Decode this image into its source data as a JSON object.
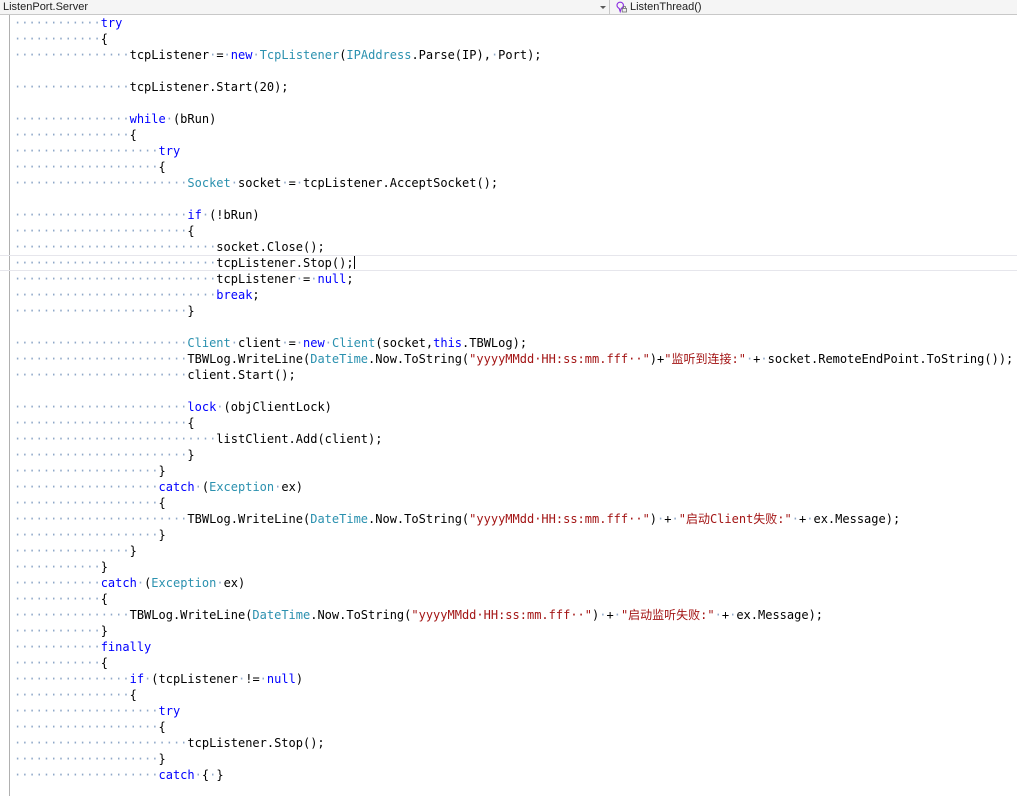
{
  "nav": {
    "type_combo": {
      "value": "ListenPort.Server",
      "dropdown_icon": "chevron-down-icon"
    },
    "member_combo": {
      "value": "ListenThread()",
      "icon": "private-method-icon"
    }
  },
  "editor": {
    "current_line_index": 15,
    "caret_after_text": "tcpListener.Stop();",
    "colors": {
      "keyword": "#0000ff",
      "type": "#2b91af",
      "string": "#a31515",
      "plain": "#000000",
      "whitespace_dot": "#8fa8c8",
      "current_line_border": "#e6e6ec",
      "margin_border": "#b0b0b0",
      "background": "#ffffff"
    },
    "lines": [
      [
        [
          "ws",
          "············"
        ],
        [
          "kw",
          "try"
        ]
      ],
      [
        [
          "ws",
          "············"
        ],
        [
          "pl",
          "{"
        ]
      ],
      [
        [
          "ws",
          "················"
        ],
        [
          "pl",
          "tcpListener"
        ],
        [
          "ws",
          "·"
        ],
        [
          "pl",
          "="
        ],
        [
          "ws",
          "·"
        ],
        [
          "kw",
          "new"
        ],
        [
          "ws",
          "·"
        ],
        [
          "typ",
          "TcpListener"
        ],
        [
          "pl",
          "("
        ],
        [
          "typ",
          "IPAddress"
        ],
        [
          "pl",
          ".Parse(IP),"
        ],
        [
          "ws",
          "·"
        ],
        [
          "pl",
          "Port);"
        ]
      ],
      [],
      [
        [
          "ws",
          "················"
        ],
        [
          "pl",
          "tcpListener.Start(20);"
        ]
      ],
      [],
      [
        [
          "ws",
          "················"
        ],
        [
          "kw",
          "while"
        ],
        [
          "ws",
          "·"
        ],
        [
          "pl",
          "(bRun)"
        ]
      ],
      [
        [
          "ws",
          "················"
        ],
        [
          "pl",
          "{"
        ]
      ],
      [
        [
          "ws",
          "····················"
        ],
        [
          "kw",
          "try"
        ]
      ],
      [
        [
          "ws",
          "····················"
        ],
        [
          "pl",
          "{"
        ]
      ],
      [
        [
          "ws",
          "························"
        ],
        [
          "typ",
          "Socket"
        ],
        [
          "ws",
          "·"
        ],
        [
          "pl",
          "socket"
        ],
        [
          "ws",
          "·"
        ],
        [
          "pl",
          "="
        ],
        [
          "ws",
          "·"
        ],
        [
          "pl",
          "tcpListener.AcceptSocket();"
        ]
      ],
      [],
      [
        [
          "ws",
          "························"
        ],
        [
          "kw",
          "if"
        ],
        [
          "ws",
          "·"
        ],
        [
          "pl",
          "(!bRun)"
        ]
      ],
      [
        [
          "ws",
          "························"
        ],
        [
          "pl",
          "{"
        ]
      ],
      [
        [
          "ws",
          "····························"
        ],
        [
          "pl",
          "socket.Close();"
        ]
      ],
      [
        [
          "ws",
          "····························"
        ],
        [
          "pl",
          "tcpListener.Stop();"
        ]
      ],
      [
        [
          "ws",
          "····························"
        ],
        [
          "pl",
          "tcpListener"
        ],
        [
          "ws",
          "·"
        ],
        [
          "pl",
          "="
        ],
        [
          "ws",
          "·"
        ],
        [
          "kw",
          "null"
        ],
        [
          "pl",
          ";"
        ]
      ],
      [
        [
          "ws",
          "····························"
        ],
        [
          "kw",
          "break"
        ],
        [
          "pl",
          ";"
        ]
      ],
      [
        [
          "ws",
          "························"
        ],
        [
          "pl",
          "}"
        ]
      ],
      [],
      [
        [
          "ws",
          "························"
        ],
        [
          "typ",
          "Client"
        ],
        [
          "ws",
          "·"
        ],
        [
          "pl",
          "client"
        ],
        [
          "ws",
          "·"
        ],
        [
          "pl",
          "="
        ],
        [
          "ws",
          "·"
        ],
        [
          "kw",
          "new"
        ],
        [
          "ws",
          "·"
        ],
        [
          "typ",
          "Client"
        ],
        [
          "pl",
          "(socket,"
        ],
        [
          "kw",
          "this"
        ],
        [
          "pl",
          ".TBWLog);"
        ]
      ],
      [
        [
          "ws",
          "························"
        ],
        [
          "pl",
          "TBWLog.WriteLine("
        ],
        [
          "typ",
          "DateTime"
        ],
        [
          "pl",
          ".Now.ToString("
        ],
        [
          "str",
          "\"yyyyMMdd·HH:ss:mm.fff··\""
        ],
        [
          "pl",
          ")+"
        ],
        [
          "str",
          "\"监听到连接:\""
        ],
        [
          "ws",
          "·"
        ],
        [
          "pl",
          "+"
        ],
        [
          "ws",
          "·"
        ],
        [
          "pl",
          "socket.RemoteEndPoint.ToString());"
        ]
      ],
      [
        [
          "ws",
          "························"
        ],
        [
          "pl",
          "client.Start();"
        ]
      ],
      [],
      [
        [
          "ws",
          "························"
        ],
        [
          "kw",
          "lock"
        ],
        [
          "ws",
          "·"
        ],
        [
          "pl",
          "(objClientLock)"
        ]
      ],
      [
        [
          "ws",
          "························"
        ],
        [
          "pl",
          "{"
        ]
      ],
      [
        [
          "ws",
          "····························"
        ],
        [
          "pl",
          "listClient.Add(client);"
        ]
      ],
      [
        [
          "ws",
          "························"
        ],
        [
          "pl",
          "}"
        ]
      ],
      [
        [
          "ws",
          "····················"
        ],
        [
          "pl",
          "}"
        ]
      ],
      [
        [
          "ws",
          "····················"
        ],
        [
          "kw",
          "catch"
        ],
        [
          "ws",
          "·"
        ],
        [
          "pl",
          "("
        ],
        [
          "typ",
          "Exception"
        ],
        [
          "ws",
          "·"
        ],
        [
          "pl",
          "ex)"
        ]
      ],
      [
        [
          "ws",
          "····················"
        ],
        [
          "pl",
          "{"
        ]
      ],
      [
        [
          "ws",
          "························"
        ],
        [
          "pl",
          "TBWLog.WriteLine("
        ],
        [
          "typ",
          "DateTime"
        ],
        [
          "pl",
          ".Now.ToString("
        ],
        [
          "str",
          "\"yyyyMMdd·HH:ss:mm.fff··\""
        ],
        [
          "pl",
          ")"
        ],
        [
          "ws",
          "·"
        ],
        [
          "pl",
          "+"
        ],
        [
          "ws",
          "·"
        ],
        [
          "str",
          "\"启动Client失败:\""
        ],
        [
          "ws",
          "·"
        ],
        [
          "pl",
          "+"
        ],
        [
          "ws",
          "·"
        ],
        [
          "pl",
          "ex.Message);"
        ]
      ],
      [
        [
          "ws",
          "····················"
        ],
        [
          "pl",
          "}"
        ]
      ],
      [
        [
          "ws",
          "················"
        ],
        [
          "pl",
          "}"
        ]
      ],
      [
        [
          "ws",
          "············"
        ],
        [
          "pl",
          "}"
        ]
      ],
      [
        [
          "ws",
          "············"
        ],
        [
          "kw",
          "catch"
        ],
        [
          "ws",
          "·"
        ],
        [
          "pl",
          "("
        ],
        [
          "typ",
          "Exception"
        ],
        [
          "ws",
          "·"
        ],
        [
          "pl",
          "ex)"
        ]
      ],
      [
        [
          "ws",
          "············"
        ],
        [
          "pl",
          "{"
        ]
      ],
      [
        [
          "ws",
          "················"
        ],
        [
          "pl",
          "TBWLog.WriteLine("
        ],
        [
          "typ",
          "DateTime"
        ],
        [
          "pl",
          ".Now.ToString("
        ],
        [
          "str",
          "\"yyyyMMdd·HH:ss:mm.fff··\""
        ],
        [
          "pl",
          ")"
        ],
        [
          "ws",
          "·"
        ],
        [
          "pl",
          "+"
        ],
        [
          "ws",
          "·"
        ],
        [
          "str",
          "\"启动监听失败:\""
        ],
        [
          "ws",
          "·"
        ],
        [
          "pl",
          "+"
        ],
        [
          "ws",
          "·"
        ],
        [
          "pl",
          "ex.Message);"
        ]
      ],
      [
        [
          "ws",
          "············"
        ],
        [
          "pl",
          "}"
        ]
      ],
      [
        [
          "ws",
          "············"
        ],
        [
          "kw",
          "finally"
        ]
      ],
      [
        [
          "ws",
          "············"
        ],
        [
          "pl",
          "{"
        ]
      ],
      [
        [
          "ws",
          "················"
        ],
        [
          "kw",
          "if"
        ],
        [
          "ws",
          "·"
        ],
        [
          "pl",
          "(tcpListener"
        ],
        [
          "ws",
          "·"
        ],
        [
          "pl",
          "!="
        ],
        [
          "ws",
          "·"
        ],
        [
          "kw",
          "null"
        ],
        [
          "pl",
          ")"
        ]
      ],
      [
        [
          "ws",
          "················"
        ],
        [
          "pl",
          "{"
        ]
      ],
      [
        [
          "ws",
          "····················"
        ],
        [
          "kw",
          "try"
        ]
      ],
      [
        [
          "ws",
          "····················"
        ],
        [
          "pl",
          "{"
        ]
      ],
      [
        [
          "ws",
          "························"
        ],
        [
          "pl",
          "tcpListener.Stop();"
        ]
      ],
      [
        [
          "ws",
          "····················"
        ],
        [
          "pl",
          "}"
        ]
      ],
      [
        [
          "ws",
          "····················"
        ],
        [
          "kw",
          "catch"
        ],
        [
          "ws",
          "·"
        ],
        [
          "pl",
          "{"
        ],
        [
          "ws",
          "·"
        ],
        [
          "pl",
          "}"
        ]
      ]
    ]
  }
}
